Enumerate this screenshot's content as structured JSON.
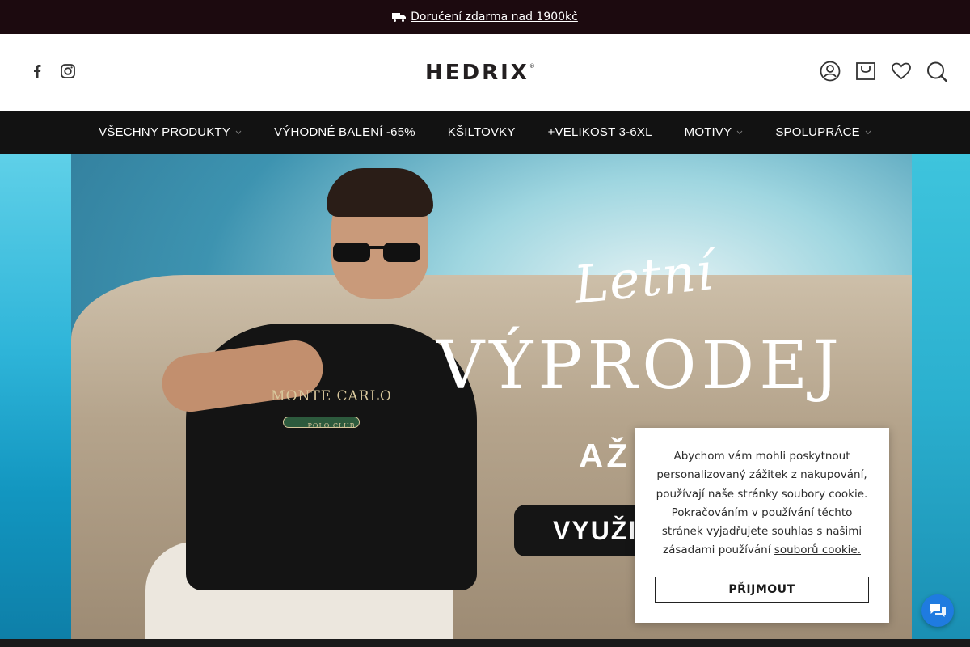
{
  "announcement": {
    "text": "Doručení zdarma nad 1900kč",
    "icon": "truck-icon"
  },
  "header": {
    "logo_text": "HEDRIX",
    "logo_mark": "®",
    "social": [
      "facebook-icon",
      "instagram-icon"
    ],
    "actions": [
      "account-icon",
      "cart-icon",
      "wishlist-icon",
      "search-icon"
    ]
  },
  "nav": {
    "items": [
      {
        "label": "VŠECHNY PRODUKTY",
        "has_dropdown": true
      },
      {
        "label": "VÝHODNÉ BALENÍ -65%",
        "has_dropdown": false
      },
      {
        "label": "KŠILTOVKY",
        "has_dropdown": false
      },
      {
        "label": "+VELIKOST 3-6XL",
        "has_dropdown": false
      },
      {
        "label": "MOTIVY",
        "has_dropdown": true
      },
      {
        "label": "SPOLUPRÁCE",
        "has_dropdown": true
      }
    ]
  },
  "hero": {
    "script_text": "Letní",
    "headline": "VÝPRODEJ",
    "sub_visible": "AŽ",
    "cta_visible": "VYUŽIJ",
    "shirt_print_top": "MONTE CARLO",
    "shirt_print_bottom": "POLO CLUB"
  },
  "cookie": {
    "text": "Abychom vám mohli poskytnout personalizovaný zážitek z nakupování, používají naše stránky soubory cookie. Pokračováním v používání těchto stránek vyjadřujete souhlas s našimi zásadami používání ",
    "link_text": "souborů cookie.",
    "accept_label": "PŘIJMOUT"
  },
  "chat": {
    "icon": "chat-icon"
  },
  "colors": {
    "announcement_bg": "#1c0a0f",
    "nav_bg": "#121212",
    "chat_blue": "#1f7be0"
  }
}
